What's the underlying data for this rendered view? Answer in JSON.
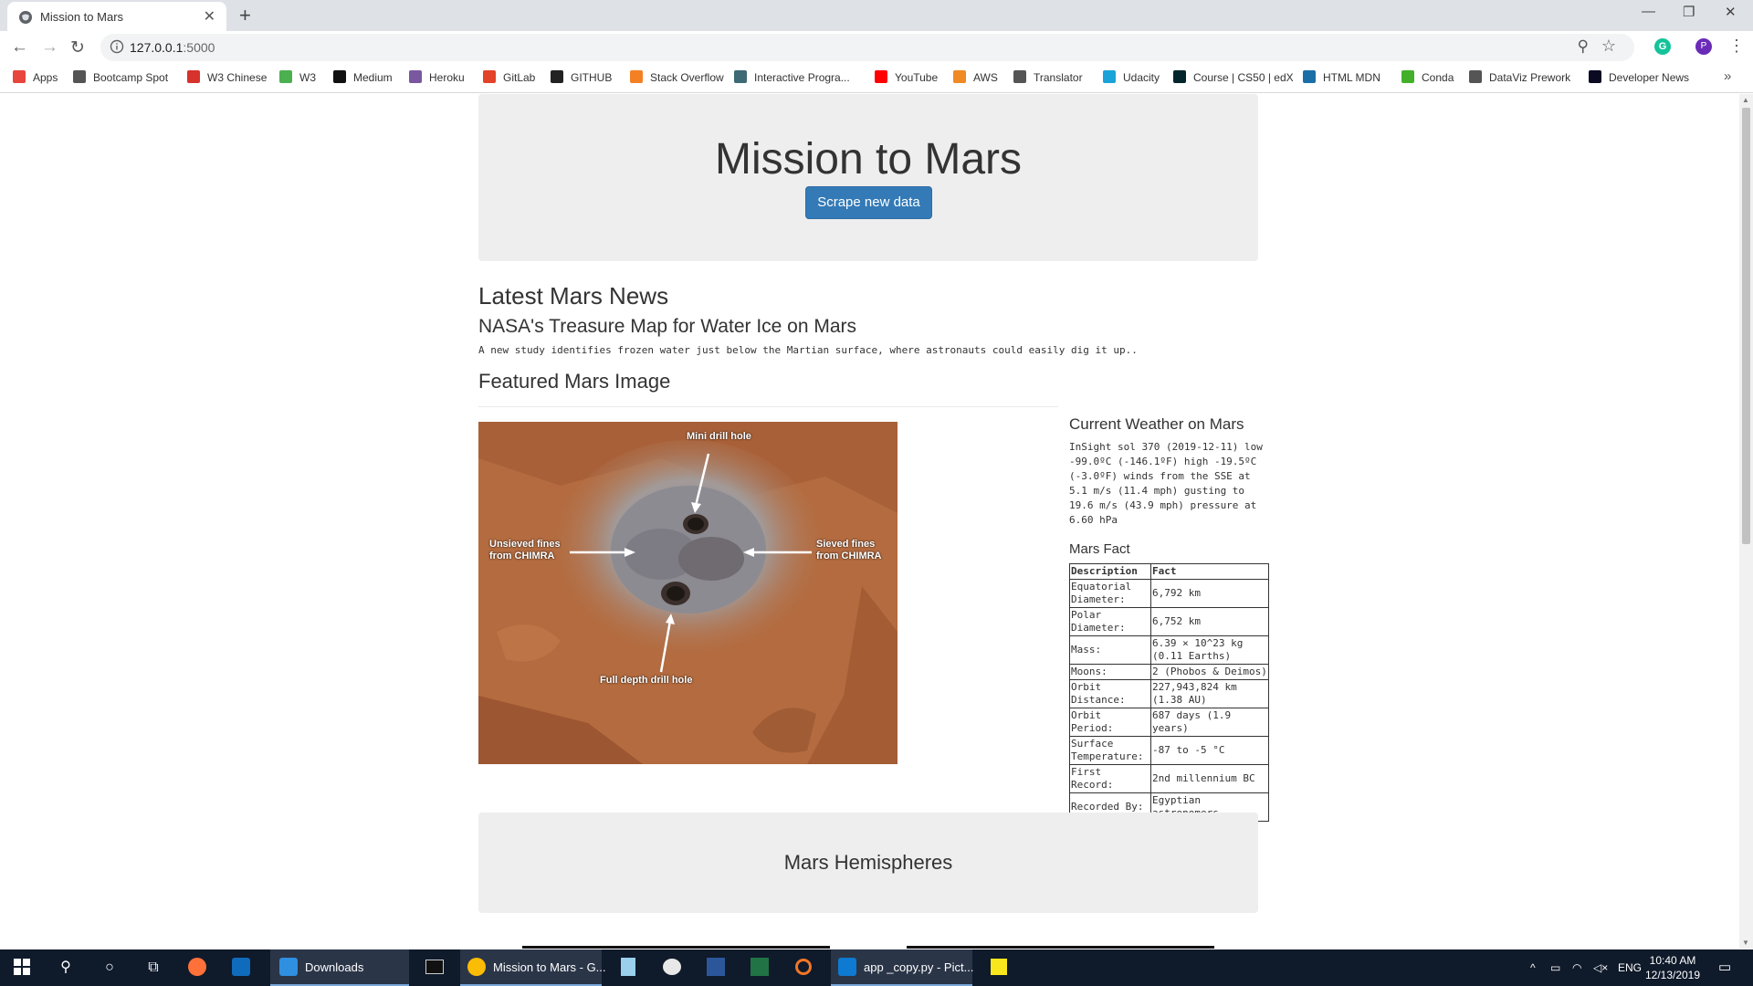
{
  "browser": {
    "tab_title": "Mission to Mars",
    "url_host": "127.0.0.1",
    "url_port": ":5000",
    "profile_initial": "P",
    "ext_initial": "G",
    "bookmarks": [
      {
        "label": "Apps",
        "color": "#e8453c"
      },
      {
        "label": "Bootcamp Spot",
        "color": "#555555"
      },
      {
        "label": "W3 Chinese",
        "color": "#d7322c"
      },
      {
        "label": "W3",
        "color": "#4caf50"
      },
      {
        "label": "Medium",
        "color": "#111111"
      },
      {
        "label": "Heroku",
        "color": "#79589f"
      },
      {
        "label": "GitLab",
        "color": "#e24329"
      },
      {
        "label": "GITHUB",
        "color": "#222222"
      },
      {
        "label": "Stack Overflow",
        "color": "#f48024"
      },
      {
        "label": "Interactive Progra...",
        "color": "#3d6a75"
      },
      {
        "label": "YouTube",
        "color": "#ff0000"
      },
      {
        "label": "AWS",
        "color": "#f08a24"
      },
      {
        "label": "Translator",
        "color": "#555555"
      },
      {
        "label": "Udacity",
        "color": "#1aa3d9"
      },
      {
        "label": "Course | CS50 | edX",
        "color": "#02262b"
      },
      {
        "label": "HTML MDN",
        "color": "#1b6fa8"
      },
      {
        "label": "Conda",
        "color": "#43b02a"
      },
      {
        "label": "DataViz Prework",
        "color": "#555555"
      },
      {
        "label": "Developer News",
        "color": "#0a0a23"
      }
    ]
  },
  "page": {
    "title": "Mission to Mars",
    "scrape_button": "Scrape new data",
    "news_heading": "Latest Mars News",
    "news_title": "NASA's Treasure Map for Water Ice on Mars",
    "news_teaser": "A new study identifies frozen water just below the Martian surface, where astronauts could easily dig it up..",
    "featured_heading": "Featured Mars Image",
    "featured_image": {
      "label_top": "Mini drill hole",
      "label_left_1": "Unsieved fines",
      "label_left_2": "from CHIMRA",
      "label_right_1": "Sieved fines",
      "label_right_2": "from CHIMRA",
      "label_bottom": "Full depth drill hole"
    },
    "weather_heading": "Current Weather on Mars",
    "weather_text": "InSight sol 370 (2019-12-11) low -99.0ºC (-146.1ºF) high -19.5ºC (-3.0ºF) winds from the SSE at 5.1 m/s (11.4 mph) gusting to 19.6 m/s (43.9 mph) pressure at 6.60 hPa",
    "facts_heading": "Mars Fact",
    "facts_columns": [
      "Description",
      "Fact"
    ],
    "facts": [
      [
        "Equatorial Diameter:",
        "6,792 km"
      ],
      [
        "Polar Diameter:",
        "6,752 km"
      ],
      [
        "Mass:",
        "6.39 × 10^23 kg (0.11 Earths)"
      ],
      [
        "Moons:",
        "2 (Phobos & Deimos)"
      ],
      [
        "Orbit Distance:",
        "227,943,824 km (1.38 AU)"
      ],
      [
        "Orbit Period:",
        "687 days (1.9 years)"
      ],
      [
        "Surface Temperature:",
        "-87 to -5 °C"
      ],
      [
        "First Record:",
        "2nd millennium BC"
      ],
      [
        "Recorded By:",
        "Egyptian astronomers"
      ]
    ],
    "hemispheres_heading": "Mars Hemispheres"
  },
  "taskbar": {
    "downloads_label": "Downloads",
    "chrome_label": "Mission to Mars - G...",
    "vscode_label": "app _copy.py - Pict...",
    "language": "ENG",
    "time": "10:40 AM",
    "date": "12/13/2019"
  },
  "colors": {
    "accent_button": "#337ab7",
    "jumbotron_bg": "#eeeeee",
    "taskbar_bg": "#0f1a2b"
  }
}
